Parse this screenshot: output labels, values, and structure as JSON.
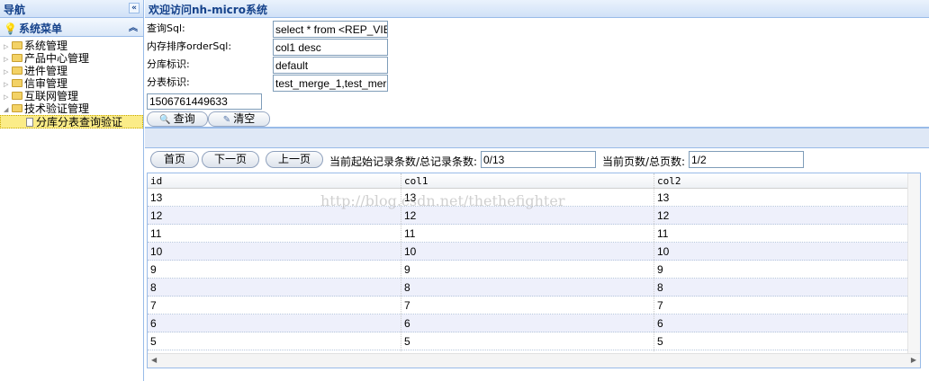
{
  "nav": {
    "title": "导航",
    "collapse_glyph": "«",
    "menu_title": "系统菜单",
    "menu_collapse_glyph": "︽",
    "items": [
      {
        "label": "系统管理"
      },
      {
        "label": "产品中心管理"
      },
      {
        "label": "进件管理"
      },
      {
        "label": "信审管理"
      },
      {
        "label": "互联网管理"
      },
      {
        "label": "技术验证管理"
      }
    ],
    "selected_child": "分库分表查询验证"
  },
  "main": {
    "title": "欢迎访问nh-micro系统",
    "form": {
      "query_sql_label": "查询Sql:",
      "query_sql_value": "select * from <REP_VIE",
      "order_sql_label": "内存排序orderSql:",
      "order_sql_value": "col1 desc",
      "db_label": "分库标识:",
      "db_value": "default",
      "table_label": "分表标识:",
      "table_value": "test_merge_1,test_mer",
      "timestamp_value": "1506761449633",
      "query_button": "查询",
      "clear_button": "清空"
    },
    "pager": {
      "first": "首页",
      "next": "下一页",
      "prev": "上一页",
      "start_label": "当前起始记录条数/总记录条数:",
      "start_value": "0/13",
      "page_label": "当前页数/总页数:",
      "page_value": "1/2"
    },
    "grid": {
      "columns": [
        "id",
        "col1",
        "col2"
      ],
      "rows": [
        [
          "13",
          "13",
          "13"
        ],
        [
          "12",
          "12",
          "12"
        ],
        [
          "11",
          "11",
          "11"
        ],
        [
          "10",
          "10",
          "10"
        ],
        [
          "9",
          "9",
          "9"
        ],
        [
          "8",
          "8",
          "8"
        ],
        [
          "7",
          "7",
          "7"
        ],
        [
          "6",
          "6",
          "6"
        ],
        [
          "5",
          "5",
          "5"
        ]
      ]
    },
    "watermark": "http://blog.csdn.net/thethefighter"
  }
}
